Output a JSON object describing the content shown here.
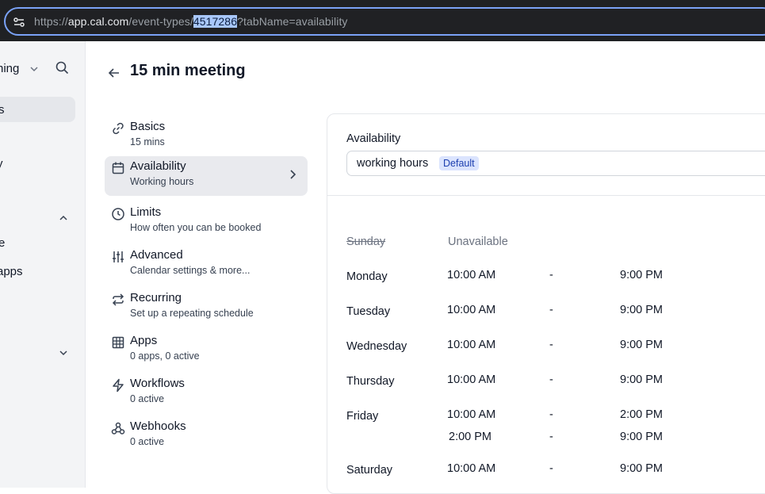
{
  "browser": {
    "url_prefix": "https://",
    "url_host": "app.cal.com",
    "url_path": "/event-types/",
    "url_selected": "4517286",
    "url_query": "?tabName=availability"
  },
  "rail": {
    "items": [
      {
        "label": "ning"
      },
      {
        "label": "s"
      },
      {
        "label": "y"
      },
      {
        "label": "e"
      },
      {
        "label": "apps"
      }
    ]
  },
  "header": {
    "title": "15 min meeting"
  },
  "nav": {
    "items": [
      {
        "title": "Basics",
        "sub": "15 mins",
        "icon": "link-icon"
      },
      {
        "title": "Availability",
        "sub": "Working hours",
        "icon": "calendar-icon"
      },
      {
        "title": "Limits",
        "sub": "How often you can be booked",
        "icon": "clock-icon"
      },
      {
        "title": "Advanced",
        "sub": "Calendar settings & more...",
        "icon": "sliders-icon"
      },
      {
        "title": "Recurring",
        "sub": "Set up a repeating schedule",
        "icon": "repeat-icon"
      },
      {
        "title": "Apps",
        "sub": "0 apps, 0 active",
        "icon": "grid-icon"
      },
      {
        "title": "Workflows",
        "sub": "0 active",
        "icon": "zap-icon"
      },
      {
        "title": "Webhooks",
        "sub": "0 active",
        "icon": "webhook-icon"
      }
    ]
  },
  "availability": {
    "label": "Availability",
    "schedule": "working hours",
    "badge": "Default",
    "unavailable_label": "Unavailable",
    "dash": "-",
    "days": [
      {
        "name": "Sunday",
        "available": false,
        "slots": []
      },
      {
        "name": "Monday",
        "available": true,
        "slots": [
          {
            "start": "10:00 AM",
            "end": "9:00 PM"
          }
        ]
      },
      {
        "name": "Tuesday",
        "available": true,
        "slots": [
          {
            "start": "10:00 AM",
            "end": "9:00 PM"
          }
        ]
      },
      {
        "name": "Wednesday",
        "available": true,
        "slots": [
          {
            "start": "10:00 AM",
            "end": "9:00 PM"
          }
        ]
      },
      {
        "name": "Thursday",
        "available": true,
        "slots": [
          {
            "start": "10:00 AM",
            "end": "9:00 PM"
          }
        ]
      },
      {
        "name": "Friday",
        "available": true,
        "slots": [
          {
            "start": "10:00 AM",
            "end": "2:00 PM"
          },
          {
            "start": "2:00 PM",
            "end": "9:00 PM"
          }
        ]
      },
      {
        "name": "Saturday",
        "available": true,
        "slots": [
          {
            "start": "10:00 AM",
            "end": "9:00 PM"
          }
        ]
      }
    ]
  }
}
